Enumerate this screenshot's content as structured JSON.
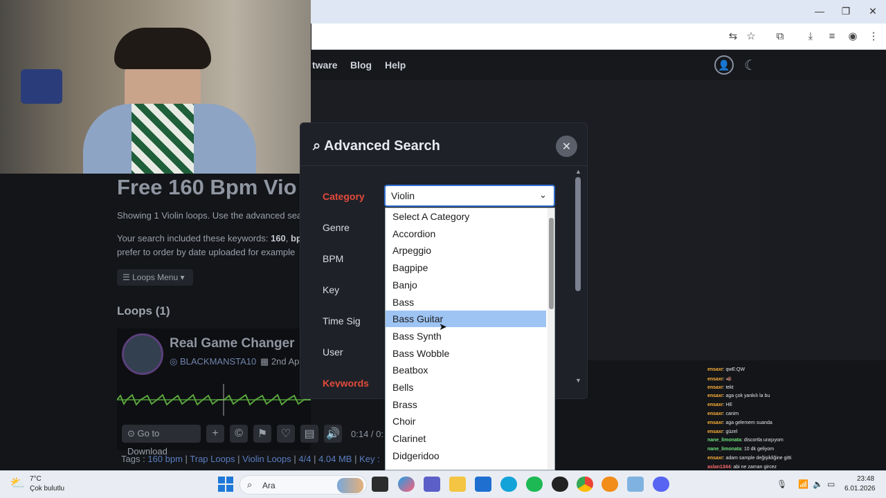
{
  "window": {
    "minimize": "—",
    "maximize": "❐",
    "close": "✕"
  },
  "nav": {
    "link1": "tware",
    "link2": "Blog",
    "link3": "Help"
  },
  "page": {
    "heading": "Free 160 Bpm Vio",
    "showing": "Showing 1 Violin loops. Use the advanced sea",
    "keywords_prefix": "Your search included these keywords: ",
    "kw1": "160",
    "kw_sep": ", ",
    "kw2": "bp",
    "order_note": "prefer to order by date uploaded for example",
    "loops_menu": "Loops Menu",
    "loops_count": "Loops (1)",
    "loop_title": "Real Game Changer",
    "loop_user": "BLACKMANSTA10",
    "loop_date": "2nd Ap",
    "go_download": "Go to Download",
    "time": "0:14 / 0:",
    "tags_label": "Tags :",
    "tags": [
      "160 bpm",
      "Trap Loops",
      "Violin Loops",
      "4/4",
      "4.04 MB",
      "Key :"
    ]
  },
  "modal": {
    "title": "Advanced Search",
    "labels": {
      "category": "Category",
      "genre": "Genre",
      "bpm": "BPM",
      "key": "Key",
      "timesig": "Time Sig",
      "user": "User",
      "keywords": "Keywords"
    },
    "selected_value": "Violin",
    "options": [
      "Select A Category",
      "Accordion",
      "Arpeggio",
      "Bagpipe",
      "Banjo",
      "Bass",
      "Bass Guitar",
      "Bass Synth",
      "Bass Wobble",
      "Beatbox",
      "Bells",
      "Brass",
      "Choir",
      "Clarinet",
      "Didgeridoo",
      "D"
    ],
    "highlighted": "Bass Guitar"
  },
  "chat": [
    {
      "user": "ensaxr",
      "msg": ": qwE:QW",
      "c": "o"
    },
    {
      "user": "ensaxr",
      "msg": ": 🐗",
      "c": "o"
    },
    {
      "user": "ensaxr",
      "msg": ": tekt",
      "c": "o"
    },
    {
      "user": "ensaxr",
      "msg": ": aga çok yankılı la bu",
      "c": "o"
    },
    {
      "user": "ensaxr",
      "msg": ": HE",
      "c": "o"
    },
    {
      "user": "ensaxr",
      "msg": ": canim",
      "c": "o"
    },
    {
      "user": "ensaxr",
      "msg": ": aga gelemem suanda",
      "c": "o"
    },
    {
      "user": "ensaxr",
      "msg": ": güzel",
      "c": "o"
    },
    {
      "user": "nane_limonata",
      "msg": ": discortla uraşıyom",
      "c": "g"
    },
    {
      "user": "nane_limonata",
      "msg": ": 10 dk geliyom",
      "c": "g"
    },
    {
      "user": "ensaxr",
      "msg": ": adam sample değişikliğine gitti",
      "c": "o"
    },
    {
      "user": "aslan1344",
      "msg": ": abi ne zaman gircez",
      "c": "r"
    }
  ],
  "taskbar": {
    "weather_temp": "7°C",
    "weather_desc": "Çok bulutlu",
    "search": "Ara",
    "time": "23:48",
    "date": "6.01.2026"
  },
  "colors": {
    "accent_red": "#e34b3b",
    "select_border": "#2f6fd0",
    "highlight": "#9ec4f4"
  }
}
